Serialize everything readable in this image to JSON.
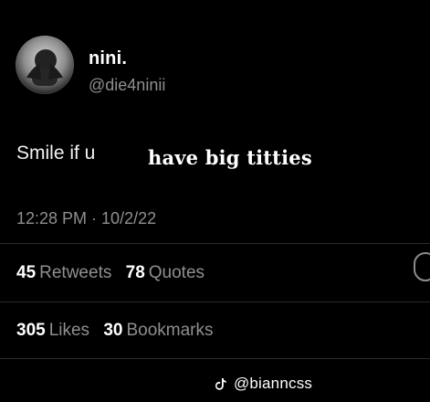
{
  "tweet": {
    "display_name": "nini.",
    "handle": "@die4ninii",
    "text": "Smile if u",
    "overlay_text": "have big titties",
    "timestamp": "12:28 PM · 10/2/22"
  },
  "stats": {
    "retweets": {
      "count": "45",
      "label": "Retweets"
    },
    "quotes": {
      "count": "78",
      "label": "Quotes"
    },
    "likes": {
      "count": "305",
      "label": "Likes"
    },
    "bookmarks": {
      "count": "30",
      "label": "Bookmarks"
    }
  },
  "watermark": {
    "icon": "tiktok-icon",
    "text": "@biannсss"
  },
  "colors": {
    "background": "#000000",
    "primary_text": "#ffffff",
    "secondary_text": "#8f8f8f",
    "divider": "#2b2b2b"
  }
}
